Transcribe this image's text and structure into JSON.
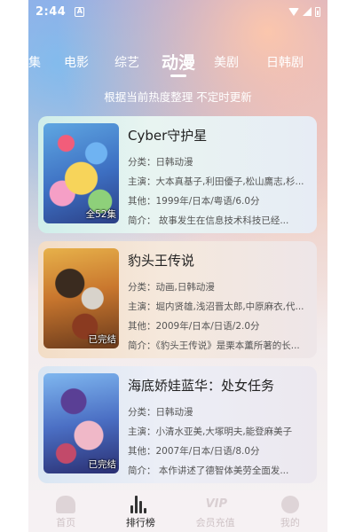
{
  "status_bar": {
    "time": "2:44",
    "notification": "A"
  },
  "tabs": [
    {
      "label": "集",
      "active": false
    },
    {
      "label": "电影",
      "active": false
    },
    {
      "label": "综艺",
      "active": false
    },
    {
      "label": "动漫",
      "active": true
    },
    {
      "label": "美剧",
      "active": false
    },
    {
      "label": "日韩剧",
      "active": false
    }
  ],
  "subtitle": "根据当前热度整理 不定时更新",
  "cards": [
    {
      "title": "Cyber守护星",
      "category": "分类：日韩动漫",
      "cast": "主演：大本真基子,利田優子,松山鷹志,杉...",
      "other": "其他：1999年/日本/粤语/6.0分",
      "intro": "简介：      故事发生在信息技术科技已经...",
      "badge": "全52集"
    },
    {
      "title": "豹头王传说",
      "category": "分类：动画,日韩动漫",
      "cast": "主演：堀内贤雄,浅沼晋太郎,中原麻衣,代...",
      "other": "其他：2009年/日本/日语/2.0分",
      "intro": "简介：《豹头王传说》是栗本薰所著的长...",
      "badge": "已完结"
    },
    {
      "title": "海底娇娃蓝华：处女任务",
      "category": "分类：日韩动漫",
      "cast": "主演：小清水亚美,大塚明夫,能登麻美子",
      "other": "其他：2007年/日本/日语/8.0分",
      "intro": "简介：      本作讲述了德智体美劳全面发...",
      "badge": "已完结"
    }
  ],
  "bottom_nav": [
    {
      "label": "首页",
      "icon": "home-icon",
      "active": false
    },
    {
      "label": "排行榜",
      "icon": "ranking-icon",
      "active": true
    },
    {
      "label": "会员充值",
      "icon": "vip-icon",
      "active": false,
      "icon_text": "VIP"
    },
    {
      "label": "我的",
      "icon": "profile-icon",
      "active": false
    }
  ],
  "colors": {
    "active_nav": "#222222",
    "inactive_nav": "#cfc3c6"
  }
}
